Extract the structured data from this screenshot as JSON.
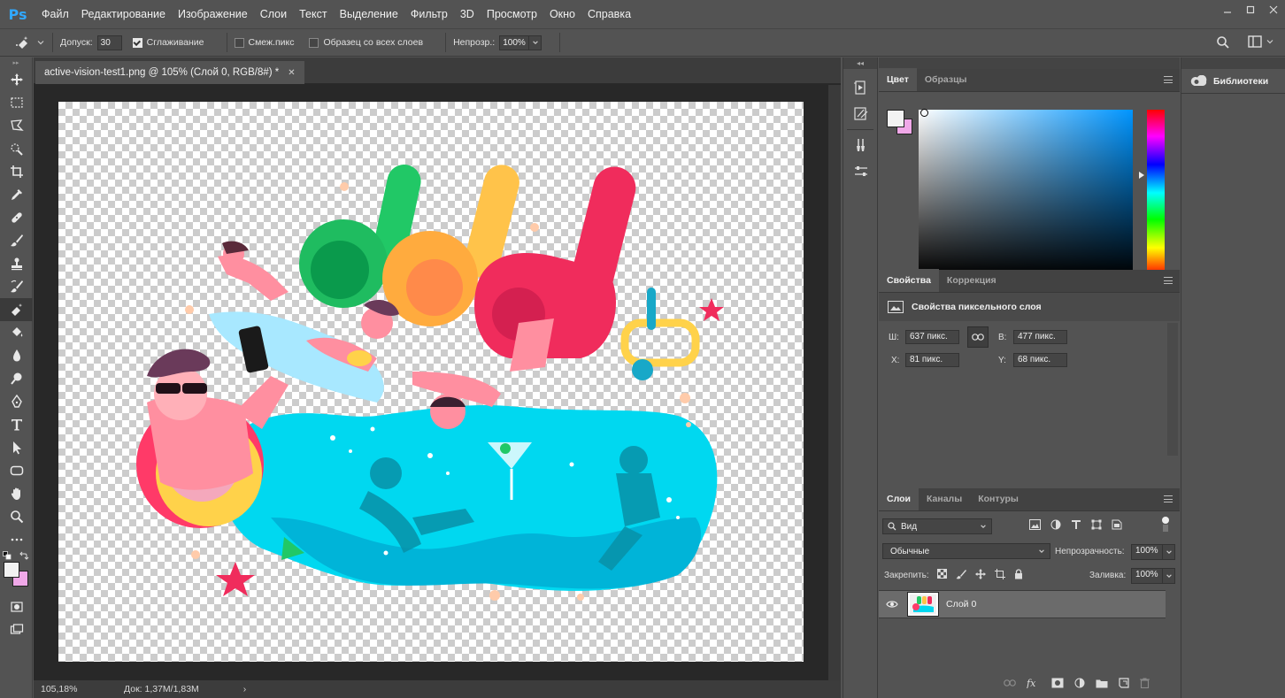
{
  "app": {
    "logo": "Ps"
  },
  "menu": [
    "Файл",
    "Редактирование",
    "Изображение",
    "Слои",
    "Текст",
    "Выделение",
    "Фильтр",
    "3D",
    "Просмотр",
    "Окно",
    "Справка"
  ],
  "options": {
    "tolerance_label": "Допуск:",
    "tolerance_value": "30",
    "antialias_label": "Сглаживание",
    "contiguous_label": "Смеж.пикс",
    "sample_all_label": "Образец со всех слоев",
    "opacity_label": "Непрозр.:",
    "opacity_value": "100%"
  },
  "document": {
    "tab_title": "active-vision-test1.png @ 105% (Слой 0, RGB/8#) *",
    "zoom": "105,18%",
    "doc_info": "Док: 1,37M/1,83M"
  },
  "color_panel": {
    "tabs": [
      "Цвет",
      "Образцы"
    ]
  },
  "properties_panel": {
    "tabs": [
      "Свойства",
      "Коррекция"
    ],
    "title": "Свойства пиксельного слоя",
    "w_label": "Ш:",
    "w_value": "637 пикс.",
    "h_label": "В:",
    "h_value": "477 пикс.",
    "x_label": "X:",
    "x_value": "81 пикс.",
    "y_label": "Y:",
    "y_value": "68 пикс."
  },
  "layers_panel": {
    "tabs": [
      "Слои",
      "Каналы",
      "Контуры"
    ],
    "filter_label": "Вид",
    "blend_mode": "Обычные",
    "opacity_label": "Непрозрачность:",
    "opacity_value": "100%",
    "lock_label": "Закрепить:",
    "fill_label": "Заливка:",
    "fill_value": "100%",
    "layer_name": "Слой 0"
  },
  "libraries": {
    "title": "Библиотеки"
  },
  "colors": {
    "fg": "#f2f2f2",
    "bg": "#f0a8e8",
    "accent": "#31a8ff"
  }
}
